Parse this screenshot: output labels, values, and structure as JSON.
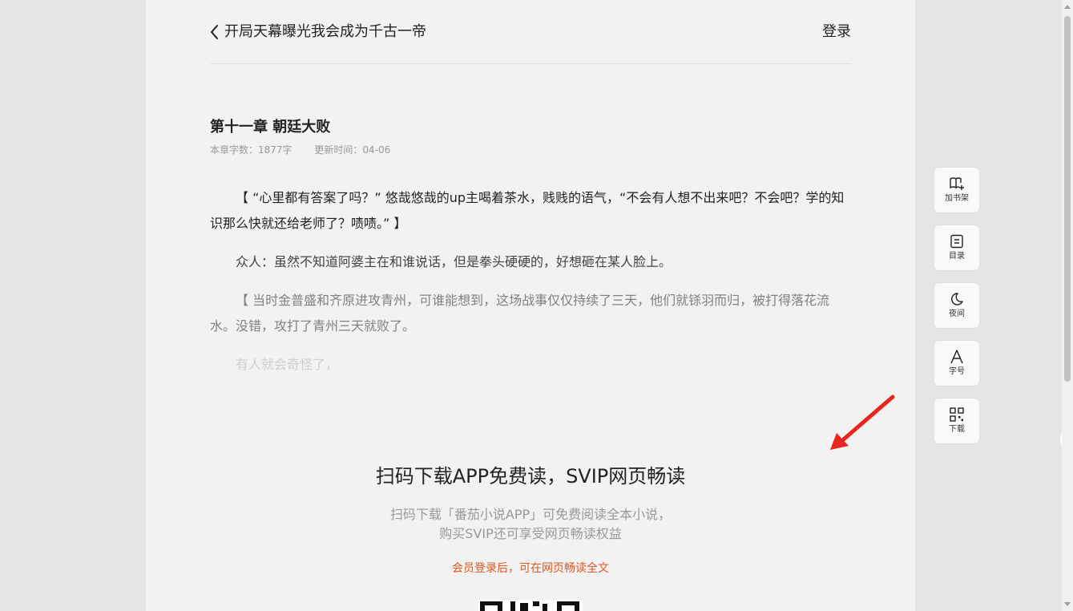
{
  "header": {
    "book_title": "开局天幕曝光我会成为千古一帝",
    "login_label": "登录"
  },
  "chapter": {
    "title": "第十一章 朝廷大败",
    "word_count": "本章字数：1877字",
    "update_time": "更新时间：04-06"
  },
  "paragraphs": [
    "【 “心里都有答案了吗？” 悠哉悠哉的up主喝着茶水，贱贱的语气，“不会有人想不出来吧？不会吧？学的知识那么快就还给老师了？啧啧。” 】",
    "众人：虽然不知道阿婆主在和谁说话，但是拳头硬硬的，好想砸在某人脸上。",
    "【 当时金普盛和齐原进攻青州，可谁能想到，这场战事仅仅持续了三天，他们就铩羽而归，被打得落花流水。没错，攻打了青州三天就败了。",
    "有人就会奇怪了，"
  ],
  "promo": {
    "title": "扫码下载APP免费读，SVIP网页畅读",
    "desc_line1": "扫码下载「番茄小说APP」可免费阅读全本小说，",
    "desc_line2": "购买SVIP还可享受网页畅读权益",
    "note": "会员登录后，可在网页畅读全文"
  },
  "toolbar": {
    "items": [
      {
        "label": "加书架",
        "icon": "add-bookshelf-icon"
      },
      {
        "label": "目录",
        "icon": "catalog-icon"
      },
      {
        "label": "夜间",
        "icon": "moon-icon"
      },
      {
        "label": "字号",
        "icon": "font-size-icon"
      },
      {
        "label": "下载",
        "icon": "qr-code-icon"
      }
    ]
  },
  "colors": {
    "page_bg": "#f2f2f2",
    "outer_bg": "#e5e5e5",
    "accent_orange": "#e1551f",
    "arrow_red": "#e8261d"
  }
}
